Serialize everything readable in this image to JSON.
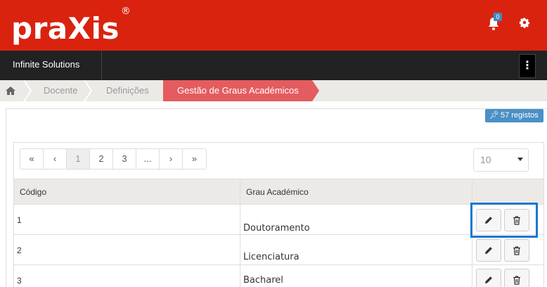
{
  "header": {
    "logo_text": "praXis",
    "logo_mark": "®",
    "notification_count": "0",
    "brand_color": "#d9230f"
  },
  "navbar": {
    "company": "Infinite Solutions",
    "menu_label": "⋮"
  },
  "breadcrumb": {
    "items": [
      "Docente",
      "Definições"
    ],
    "active": "Gestão de Graus Académicos",
    "active_color": "#e45c5f"
  },
  "records": {
    "count_label": "57 registos"
  },
  "pagination": {
    "first": "«",
    "prev": "‹",
    "pages": [
      "1",
      "2",
      "3"
    ],
    "ellipsis": "...",
    "next": "›",
    "last": "»",
    "active_page": "1"
  },
  "page_size": {
    "value": "10"
  },
  "table": {
    "columns": [
      "Código",
      "Grau Académico"
    ],
    "rows": [
      {
        "code": "1",
        "name": "Doutoramento"
      },
      {
        "code": "2",
        "name": "Licenciatura"
      },
      {
        "code": "3",
        "name": "Bacharel"
      }
    ]
  },
  "icons": {
    "edit": "pencil-icon",
    "delete": "trash-icon",
    "home": "home-icon",
    "bell": "bell-icon",
    "gear": "gear-icon",
    "pin": "pin-icon"
  }
}
